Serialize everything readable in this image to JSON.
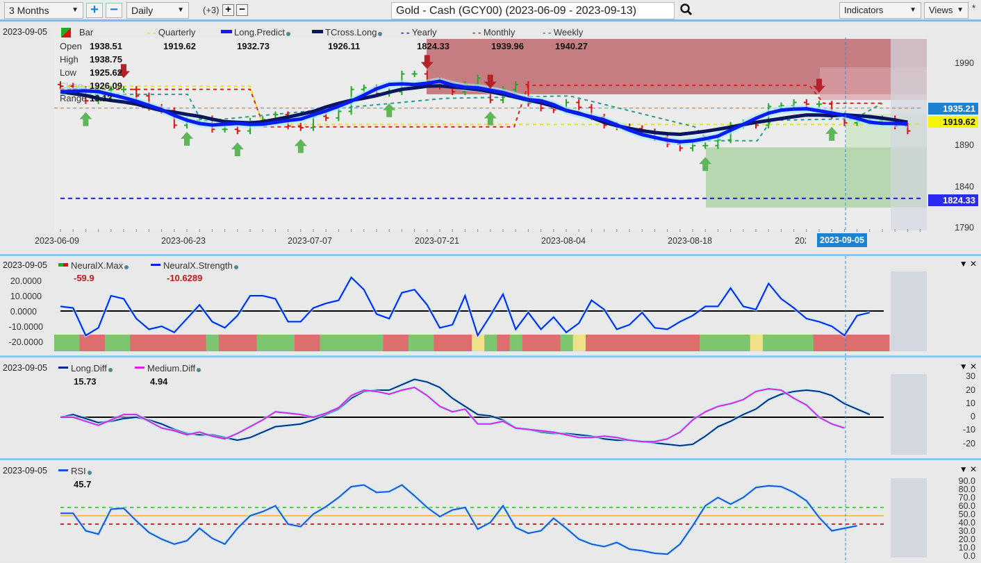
{
  "toolbar": {
    "range_select": "3 Months",
    "zoom_in": "+",
    "zoom_out": "−",
    "interval_select": "Daily",
    "interval_extra": "(+3)",
    "add_pane": "+",
    "remove_pane": "−",
    "instrument_title": "Gold - Cash (GCY00) (2023-06-09 - 2023-09-13)",
    "search_icon": "search-icon",
    "indicators_label": "Indicators",
    "views_label": "Views",
    "views_modified": "*"
  },
  "colors": {
    "up_bar": "#22aa22",
    "down_bar": "#dd1111",
    "long_predict": "#0a1cf0",
    "tcross_long": "#0b1660",
    "yearly": "#1a1ad0",
    "monthly": "#e02020",
    "weekly": "#2a9a90",
    "quarterly": "#e8e800",
    "neural_pos": "#7dc56e",
    "neural_neg": "#dc6e6e",
    "neural_neutral": "#efe08a",
    "long_diff": "#0b2a80",
    "medium_diff": "#e020e0",
    "rsi": "#1f4fd8"
  },
  "main_panel": {
    "cursor_date": "2023-09-05",
    "bar_legend": "Bar",
    "ohlc": {
      "open_label": "Open",
      "open": "1938.51",
      "high_label": "High",
      "high": "1938.75",
      "low_label": "Low",
      "low": "1925.62",
      "close_label": "Close",
      "close": "1926.09",
      "range_label": "Range",
      "range": "13.13"
    },
    "legend": [
      {
        "name": "Quarterly",
        "value": "1919.62"
      },
      {
        "name": "Long.Predict",
        "value": "1932.73"
      },
      {
        "name": "TCross.Long",
        "value": "1926.11"
      },
      {
        "name": "Yearly",
        "value": "1824.33"
      },
      {
        "name": "Monthly",
        "value": "1939.96"
      },
      {
        "name": "Weekly",
        "value": "1940.27"
      }
    ],
    "price_tags": {
      "long_predict": "1935.21",
      "quarterly": "1919.62",
      "yearly": "1824.33"
    },
    "cursor_date_tag": "2023-09-05"
  },
  "neural_panel": {
    "cursor_date": "2023-09-05",
    "legend": [
      {
        "name": "NeuralX.Max",
        "value": "-59.9"
      },
      {
        "name": "NeuralX.Strength",
        "value": "-10.6289"
      }
    ]
  },
  "diff_panel": {
    "cursor_date": "2023-09-05",
    "legend": [
      {
        "name": "Long.Diff",
        "value": "15.73"
      },
      {
        "name": "Medium.Diff",
        "value": "4.94"
      }
    ]
  },
  "rsi_panel": {
    "cursor_date": "2023-09-05",
    "legend": [
      {
        "name": "RSI",
        "value": "45.7"
      }
    ]
  },
  "chart_data": [
    {
      "type": "ohlc",
      "title": "Gold - Cash (GCY00)",
      "x": [
        "2023-06-09",
        "2023-06-12",
        "2023-06-13",
        "2023-06-14",
        "2023-06-15",
        "2023-06-16",
        "2023-06-19",
        "2023-06-20",
        "2023-06-21",
        "2023-06-22",
        "2023-06-23",
        "2023-06-26",
        "2023-06-27",
        "2023-06-28",
        "2023-06-29",
        "2023-06-30",
        "2023-07-03",
        "2023-07-04",
        "2023-07-05",
        "2023-07-06",
        "2023-07-07",
        "2023-07-10",
        "2023-07-11",
        "2023-07-12",
        "2023-07-13",
        "2023-07-14",
        "2023-07-17",
        "2023-07-18",
        "2023-07-19",
        "2023-07-20",
        "2023-07-21",
        "2023-07-24",
        "2023-07-25",
        "2023-07-26",
        "2023-07-27",
        "2023-07-28",
        "2023-07-31",
        "2023-08-01",
        "2023-08-02",
        "2023-08-03",
        "2023-08-04",
        "2023-08-07",
        "2023-08-08",
        "2023-08-09",
        "2023-08-10",
        "2023-08-11",
        "2023-08-14",
        "2023-08-15",
        "2023-08-16",
        "2023-08-17",
        "2023-08-18",
        "2023-08-21",
        "2023-08-22",
        "2023-08-23",
        "2023-08-24",
        "2023-08-25",
        "2023-08-28",
        "2023-08-29",
        "2023-08-30",
        "2023-08-31",
        "2023-09-01",
        "2023-09-05",
        "2023-09-06",
        "2023-09-07",
        "2023-09-08",
        "2023-09-11",
        "2023-09-12",
        "2023-09-13"
      ],
      "close": [
        1962,
        1958,
        1944,
        1957,
        1958,
        1958,
        1950,
        1936,
        1932,
        1914,
        1920,
        1922,
        1909,
        1909,
        1907,
        1919,
        1921,
        1927,
        1913,
        1911,
        1925,
        1923,
        1931,
        1958,
        1960,
        1953,
        1955,
        1977,
        1977,
        1969,
        1962,
        1955,
        1964,
        1972,
        1945,
        1958,
        1964,
        1941,
        1935,
        1933,
        1942,
        1936,
        1924,
        1914,
        1912,
        1910,
        1906,
        1899,
        1891,
        1886,
        1889,
        1889,
        1896,
        1914,
        1917,
        1914,
        1937,
        1938,
        1942,
        1940,
        1940,
        1926,
        1917,
        1919,
        1920,
        1922,
        1913,
        1907
      ],
      "ylim": [
        1790,
        2020
      ],
      "yticks": [
        1790,
        1840,
        1890,
        1990
      ],
      "xticks": [
        "2023-06-09",
        "2023-06-23",
        "2023-07-07",
        "2023-07-21",
        "2023-08-04",
        "2023-08-18",
        "2023-09-05"
      ],
      "levels": {
        "quarterly": 1919.62,
        "yearly": 1824.33,
        "monthly": 1939.96,
        "weekly": 1940.27,
        "long_predict": 1932.73,
        "tcross_long": 1926.11
      }
    },
    {
      "type": "line",
      "title": "NeuralX",
      "series": [
        {
          "name": "NeuralX.Strength",
          "values": [
            3,
            2,
            -16,
            -11,
            10,
            8,
            -5,
            -12,
            -10,
            -14,
            -5,
            4,
            -7,
            -11,
            -3,
            10,
            10,
            8,
            -7,
            -7,
            2,
            5,
            7,
            22,
            14,
            -2,
            -5,
            12,
            14,
            4,
            -11,
            -9,
            10,
            -16,
            -3,
            11,
            -12,
            -1,
            -12,
            -4,
            -14,
            -8,
            7,
            1,
            -12,
            -9,
            -1,
            -11,
            -12,
            -7,
            -3,
            3,
            3,
            15,
            3,
            1,
            18,
            8,
            2,
            -5,
            -7,
            -10,
            -16,
            -3,
            -1
          ],
          "ylim": [
            -25,
            25
          ]
        },
        {
          "name": "NeuralX.Max",
          "type": "state-bar",
          "states": [
            "pos",
            "pos",
            "neg",
            "neg",
            "pos",
            "pos",
            "neg",
            "neg",
            "neg",
            "neg",
            "neg",
            "neg",
            "pos",
            "neg",
            "neg",
            "neg",
            "pos",
            "pos",
            "pos",
            "neg",
            "neg",
            "pos",
            "pos",
            "pos",
            "pos",
            "pos",
            "neg",
            "neg",
            "pos",
            "pos",
            "neg",
            "neg",
            "neg",
            "neu",
            "pos",
            "neg",
            "pos",
            "neg",
            "neg",
            "neg",
            "pos",
            "neu",
            "neg",
            "neg",
            "neg",
            "neg",
            "neg",
            "neg",
            "neg",
            "neg",
            "neg",
            "pos",
            "pos",
            "pos",
            "pos",
            "neu",
            "pos",
            "pos",
            "pos",
            "pos",
            "neg",
            "neg",
            "neg",
            "neg",
            "neg",
            "neg"
          ]
        }
      ],
      "yticks": [
        -20,
        -10,
        0,
        10,
        20
      ]
    },
    {
      "type": "line",
      "title": "Diff",
      "series": [
        {
          "name": "Long.Diff",
          "values": [
            0,
            2,
            -1,
            -4,
            -3,
            -1,
            0,
            -2,
            -5,
            -9,
            -12,
            -13,
            -13,
            -15,
            -17,
            -15,
            -11,
            -7,
            -6,
            -5,
            -2,
            2,
            6,
            14,
            19,
            20,
            20,
            24,
            28,
            26,
            22,
            14,
            8,
            2,
            1,
            -2,
            -8,
            -9,
            -11,
            -12,
            -12,
            -13,
            -14,
            -16,
            -17,
            -17,
            -18,
            -19,
            -20,
            -21,
            -20,
            -14,
            -7,
            -3,
            2,
            6,
            13,
            17,
            19,
            20,
            19,
            16,
            10,
            6,
            2
          ],
          "color": "#0b2a80"
        },
        {
          "name": "Medium.Diff",
          "values": [
            0,
            0,
            -3,
            -6,
            -2,
            2,
            2,
            -3,
            -8,
            -10,
            -13,
            -11,
            -14,
            -16,
            -12,
            -7,
            -2,
            4,
            3,
            2,
            0,
            3,
            7,
            16,
            20,
            19,
            17,
            20,
            22,
            16,
            8,
            4,
            6,
            -5,
            -5,
            -3,
            -8,
            -9,
            -10,
            -11,
            -13,
            -15,
            -15,
            -14,
            -15,
            -17,
            -18,
            -18,
            -16,
            -11,
            -2,
            4,
            8,
            10,
            13,
            19,
            21,
            20,
            14,
            9,
            0,
            -5,
            -8
          ],
          "color": "#e020e0"
        }
      ],
      "ylim": [
        -25,
        35
      ],
      "yticks": [
        -20,
        -10,
        0,
        10,
        20,
        30
      ]
    },
    {
      "type": "line",
      "title": "RSI",
      "series": [
        {
          "name": "RSI",
          "values": [
            53,
            53,
            32,
            28,
            58,
            59,
            44,
            30,
            22,
            16,
            20,
            35,
            23,
            16,
            35,
            50,
            55,
            62,
            40,
            37,
            52,
            61,
            72,
            85,
            87,
            78,
            79,
            87,
            74,
            60,
            49,
            57,
            60,
            34,
            42,
            62,
            36,
            29,
            32,
            47,
            35,
            22,
            16,
            13,
            18,
            10,
            8,
            5,
            4,
            16,
            38,
            62,
            72,
            64,
            72,
            84,
            86,
            85,
            78,
            68,
            48,
            32,
            35,
            38
          ]
        }
      ],
      "ylim": [
        0,
        95
      ],
      "yticks": [
        0,
        10,
        20,
        30,
        40,
        50,
        60,
        70,
        80,
        90
      ],
      "levels": {
        "overbought": 60,
        "mid": 50,
        "oversold": 40
      }
    }
  ]
}
